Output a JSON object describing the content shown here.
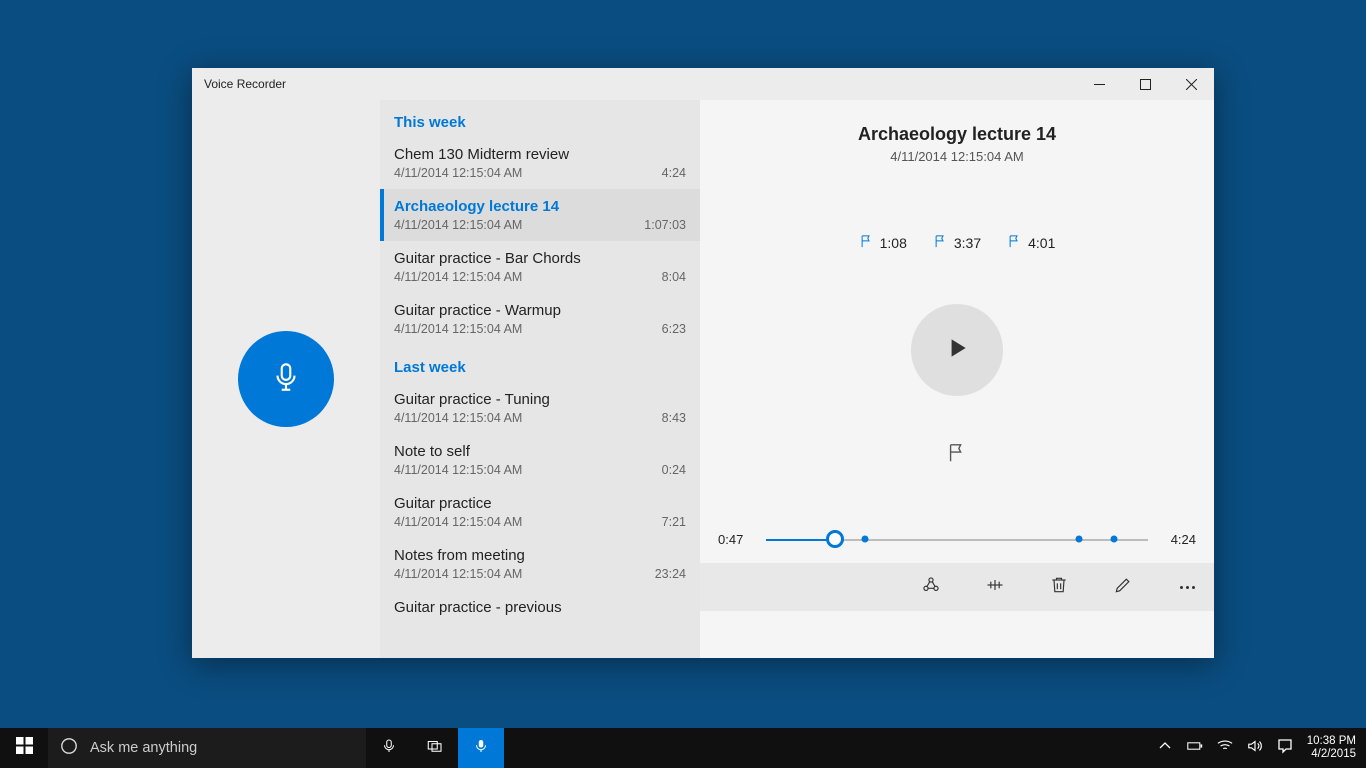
{
  "window": {
    "title": "Voice Recorder"
  },
  "list": {
    "groups": [
      {
        "label": "This week",
        "items": [
          {
            "title": "Chem 130 Midterm review",
            "date": "4/11/2014 12:15:04 AM",
            "duration": "4:24",
            "selected": false
          },
          {
            "title": "Archaeology lecture 14",
            "date": "4/11/2014 12:15:04 AM",
            "duration": "1:07:03",
            "selected": true
          },
          {
            "title": "Guitar practice - Bar Chords",
            "date": "4/11/2014 12:15:04 AM",
            "duration": "8:04",
            "selected": false
          },
          {
            "title": "Guitar practice - Warmup",
            "date": "4/11/2014 12:15:04 AM",
            "duration": "6:23",
            "selected": false
          }
        ]
      },
      {
        "label": "Last week",
        "items": [
          {
            "title": "Guitar practice - Tuning",
            "date": "4/11/2014 12:15:04 AM",
            "duration": "8:43",
            "selected": false
          },
          {
            "title": "Note to self",
            "date": "4/11/2014 12:15:04 AM",
            "duration": "0:24",
            "selected": false
          },
          {
            "title": "Guitar practice",
            "date": "4/11/2014 12:15:04 AM",
            "duration": "7:21",
            "selected": false
          },
          {
            "title": "Notes from meeting",
            "date": "4/11/2014 12:15:04 AM",
            "duration": "23:24",
            "selected": false
          },
          {
            "title": "Guitar practice - previous",
            "date": "",
            "duration": "",
            "selected": false
          }
        ]
      }
    ]
  },
  "detail": {
    "title": "Archaeology lecture 14",
    "date": "4/11/2014 12:15:04 AM",
    "markers": [
      "1:08",
      "3:37",
      "4:01"
    ],
    "current_time": "0:47",
    "total_time": "4:24",
    "progress_pct": 18,
    "marker_pct": [
      26,
      82,
      91
    ]
  },
  "taskbar": {
    "search_placeholder": "Ask me anything",
    "time": "10:38 PM",
    "date": "4/2/2015"
  }
}
